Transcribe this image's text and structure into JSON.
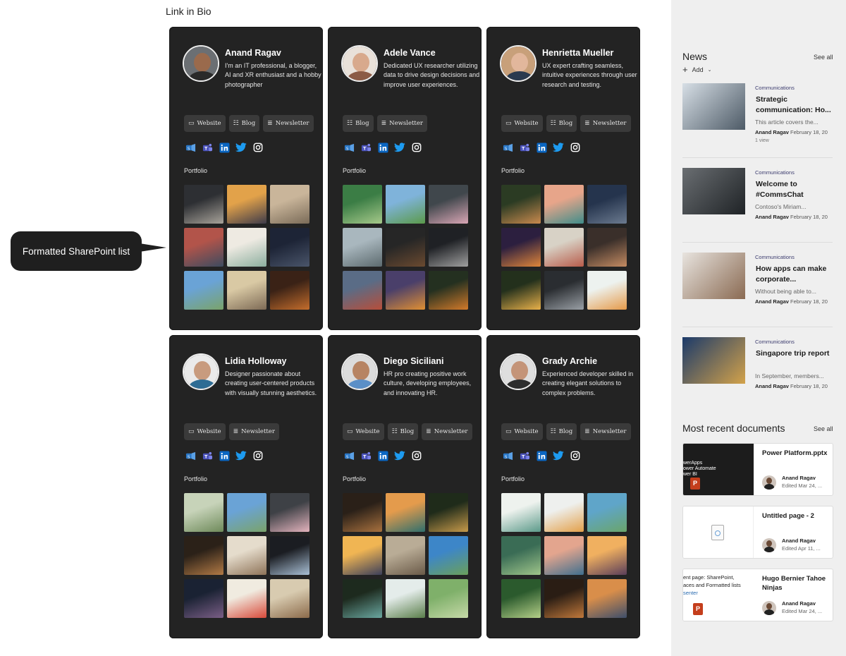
{
  "page_title": "Link in Bio",
  "callout": "Formatted SharePoint list",
  "portfolio_label": "Portfolio",
  "link_labels": {
    "website": "Website",
    "blog": "Blog",
    "newsletter": "Newsletter"
  },
  "profiles": [
    {
      "name": "Anand Ragav",
      "bio": "I'm an IT professional, a blogger, AI and XR enthusiast and a hobby photographer",
      "links": [
        "website",
        "blog",
        "newsletter"
      ],
      "avatar": {
        "bg": "#6b6f73",
        "skin": "#9a6a4c",
        "shirt": "#2a2a2a"
      },
      "gallery": [
        [
          "#2d2f33",
          "#a8a39a"
        ],
        [
          "#e2a24a",
          "#3e3b4a"
        ],
        [
          "#c9b59a",
          "#7a6b58"
        ],
        [
          "#b2544a",
          "#3c4b5f"
        ],
        [
          "#eeeae2",
          "#8cae9e"
        ],
        [
          "#1d2436",
          "#4a556a"
        ],
        [
          "#6aa3d6",
          "#7aa36a"
        ],
        [
          "#d9c9a4",
          "#7d6a55"
        ],
        [
          "#3a2216",
          "#c46d2c"
        ]
      ]
    },
    {
      "name": "Adele Vance",
      "bio": "Dedicated UX researcher utilizing data to drive design decisions and improve user experiences.",
      "links": [
        "blog",
        "newsletter"
      ],
      "avatar": {
        "bg": "#e9e1d9",
        "skin": "#d8a98c",
        "shirt": "#8b5b45"
      },
      "gallery": [
        [
          "#3b7d45",
          "#a6c98a"
        ],
        [
          "#7fb3da",
          "#5b9a4a"
        ],
        [
          "#40474c",
          "#d9a6b5"
        ],
        [
          "#a9b7be",
          "#5c6a6e"
        ],
        [
          "#262626",
          "#6b4a30"
        ],
        [
          "#1f2125",
          "#a0a0a0"
        ],
        [
          "#5a6c86",
          "#b74e3a"
        ],
        [
          "#4a3f6a",
          "#e08f33"
        ],
        [
          "#243020",
          "#d27a2a"
        ]
      ]
    },
    {
      "name": "Henrietta Mueller",
      "bio": "UX expert crafting seamless, intuitive experiences through user research and testing.",
      "links": [
        "website",
        "blog",
        "newsletter"
      ],
      "avatar": {
        "bg": "#c8a07a",
        "skin": "#e2b79c",
        "shirt": "#2b3a4f"
      },
      "gallery": [
        [
          "#2b3b23",
          "#c98a4e"
        ],
        [
          "#e7a58a",
          "#3f8d8a"
        ],
        [
          "#25344d",
          "#6b7a8f"
        ],
        [
          "#2c1f3f",
          "#e0863a"
        ],
        [
          "#d8d2c6",
          "#b85c4a"
        ],
        [
          "#3a2f2a",
          "#c48b62"
        ],
        [
          "#23301c",
          "#e8b14a"
        ],
        [
          "#2a2d31",
          "#9aa0a6"
        ],
        [
          "#edf2ef",
          "#e59a4a"
        ]
      ]
    },
    {
      "name": "Lidia Holloway",
      "bio": "Designer passionate about creating user-centered products with visually stunning aesthetics.",
      "links": [
        "website",
        "newsletter"
      ],
      "avatar": {
        "bg": "#eaeaea",
        "skin": "#c89b7e",
        "shirt": "#2e6c94"
      },
      "gallery": [
        [
          "#c7d3b9",
          "#6e8a5a"
        ],
        [
          "#6aa3d6",
          "#7aa36a"
        ],
        [
          "#3e4146",
          "#e3b3bd"
        ],
        [
          "#2b2118",
          "#b27a45"
        ],
        [
          "#e5dccc",
          "#8e7358"
        ],
        [
          "#1b1d22",
          "#a9c0d6"
        ],
        [
          "#1a2233",
          "#7a5e86"
        ],
        [
          "#f0ebe0",
          "#d84a3a"
        ],
        [
          "#d8cbb0",
          "#8b6a4a"
        ]
      ]
    },
    {
      "name": "Diego Siciliani",
      "bio": "HR pro creating positive work culture, developing employees, and innovating HR.",
      "links": [
        "website",
        "blog",
        "newsletter"
      ],
      "avatar": {
        "bg": "#dcdcdc",
        "skin": "#b78463",
        "shirt": "#5b8fc7"
      },
      "gallery": [
        [
          "#2a2018",
          "#a8713e"
        ],
        [
          "#e49b4c",
          "#2f6f6d"
        ],
        [
          "#1f2b1a",
          "#c79a4a"
        ],
        [
          "#f0b553",
          "#3b3f5a"
        ],
        [
          "#b9ac96",
          "#6a5a48"
        ],
        [
          "#3d86c8",
          "#6aa05a"
        ],
        [
          "#1d2a1e",
          "#6aa7a0"
        ],
        [
          "#e4ecea",
          "#5a7e4a"
        ],
        [
          "#7fb06a",
          "#c6d9a8"
        ]
      ]
    },
    {
      "name": "Grady Archie",
      "bio": "Experienced developer skilled in creating elegant solutions to complex problems.",
      "links": [
        "website",
        "blog",
        "newsletter"
      ],
      "avatar": {
        "bg": "#dedede",
        "skin": "#c49478",
        "shirt": "#2d2d2d"
      },
      "gallery": [
        [
          "#eef2ee",
          "#5c9a8a"
        ],
        [
          "#eef0ee",
          "#e3a04a"
        ],
        [
          "#5fa5c9",
          "#6aa56a"
        ],
        [
          "#3a6c55",
          "#9fc58a"
        ],
        [
          "#e3a58e",
          "#3f6f8e"
        ],
        [
          "#f0b060",
          "#5a3e5a"
        ],
        [
          "#2b5a2d",
          "#b4cf88"
        ],
        [
          "#2a1d14",
          "#c0783a"
        ],
        [
          "#d98e4a",
          "#3e4e6a"
        ]
      ]
    }
  ],
  "news": {
    "title": "News",
    "see_all": "See all",
    "add_label": "Add",
    "items": [
      {
        "category": "Communications",
        "title": "Strategic communication: Ho...",
        "snippet": "This article covers the...",
        "author": "Anand Ragav",
        "date": "February 18, 20",
        "views": "1 view",
        "thumb": [
          "#d7dfe6",
          "#4d5a66"
        ]
      },
      {
        "category": "Communications",
        "title": "Welcome to #CommsChat",
        "snippet": "Contoso's Miriam...",
        "author": "Anand Ragav",
        "date": "February 18, 20",
        "thumb": [
          "#6a6e72",
          "#1f2326"
        ]
      },
      {
        "category": "Communications",
        "title": "How apps can make corporate...",
        "snippet": "Without being able to...",
        "author": "Anand Ragav",
        "date": "February 18, 20",
        "thumb": [
          "#e8e4df",
          "#8a6a52"
        ]
      },
      {
        "category": "Communications",
        "title": "Singapore trip report",
        "snippet": "In September, members...",
        "author": "Anand Ragav",
        "date": "February 18, 20",
        "thumb": [
          "#1b3a6a",
          "#d3a24a"
        ]
      }
    ]
  },
  "docs": {
    "title": "Most recent documents",
    "see_all": "See all",
    "items": [
      {
        "title": "Power Platform.pptx",
        "author": "Anand Ragav",
        "edited": "Edited Mar 24, ...",
        "preview_lines": [
          "werApps",
          "ower Automate",
          "wer BI"
        ]
      },
      {
        "title": "Untitled page - 2",
        "author": "Anand Ragav",
        "edited": "Edited Apr 11, ...",
        "preview_lines": []
      },
      {
        "title": "Hugo Bernier Tahoe Ninjas",
        "author": "Anand Ragav",
        "edited": "Edited Mar 24, ...",
        "preview_lines": [
          "ent page: SharePoint,",
          "aces and Formatted lists",
          "senter"
        ]
      }
    ]
  }
}
